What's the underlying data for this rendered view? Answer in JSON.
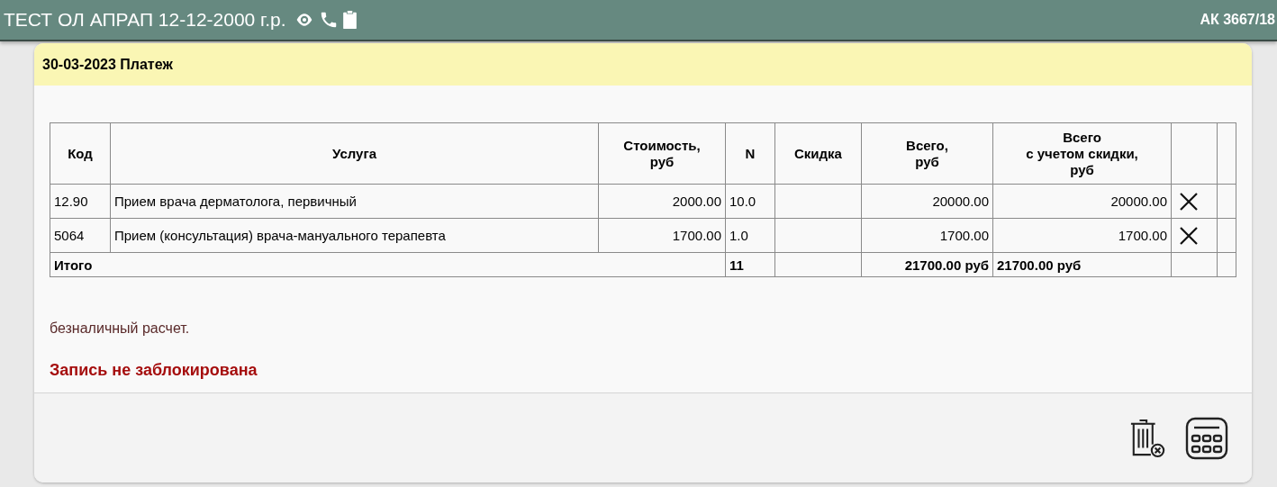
{
  "header": {
    "patient": "ТЕСТ ОЛ АПРАП 12-12-2000 г.р.",
    "card_number": "АК 3667/18"
  },
  "panel": {
    "title": "30-03-2023 Платеж",
    "table": {
      "columns": [
        "Код",
        "Услуга",
        "Стоимость,\nруб",
        "N",
        "Скидка",
        "Всего,\nруб",
        "Всего\nс учетом скидки,\nруб"
      ],
      "rows": [
        {
          "code": "12.90",
          "service": "Прием врача дерматолога, первичный",
          "price": "2000.00",
          "n": "10.0",
          "total": "20000.00",
          "total_discounted": "20000.00",
          "removable": true
        },
        {
          "code": "5064",
          "service": "Прием (консультация) врача-мануального терапевта",
          "price": "1700.00",
          "n": "1.0",
          "total": "1700.00",
          "total_discounted": "1700.00",
          "removable": true
        }
      ],
      "totals": {
        "label": "Итого",
        "n": "11",
        "total": "21700.00 руб",
        "total_discounted": "21700.00 руб"
      }
    },
    "payment_method": "безналичный расчет.",
    "lock_status": "Запись не заблокирована"
  }
}
